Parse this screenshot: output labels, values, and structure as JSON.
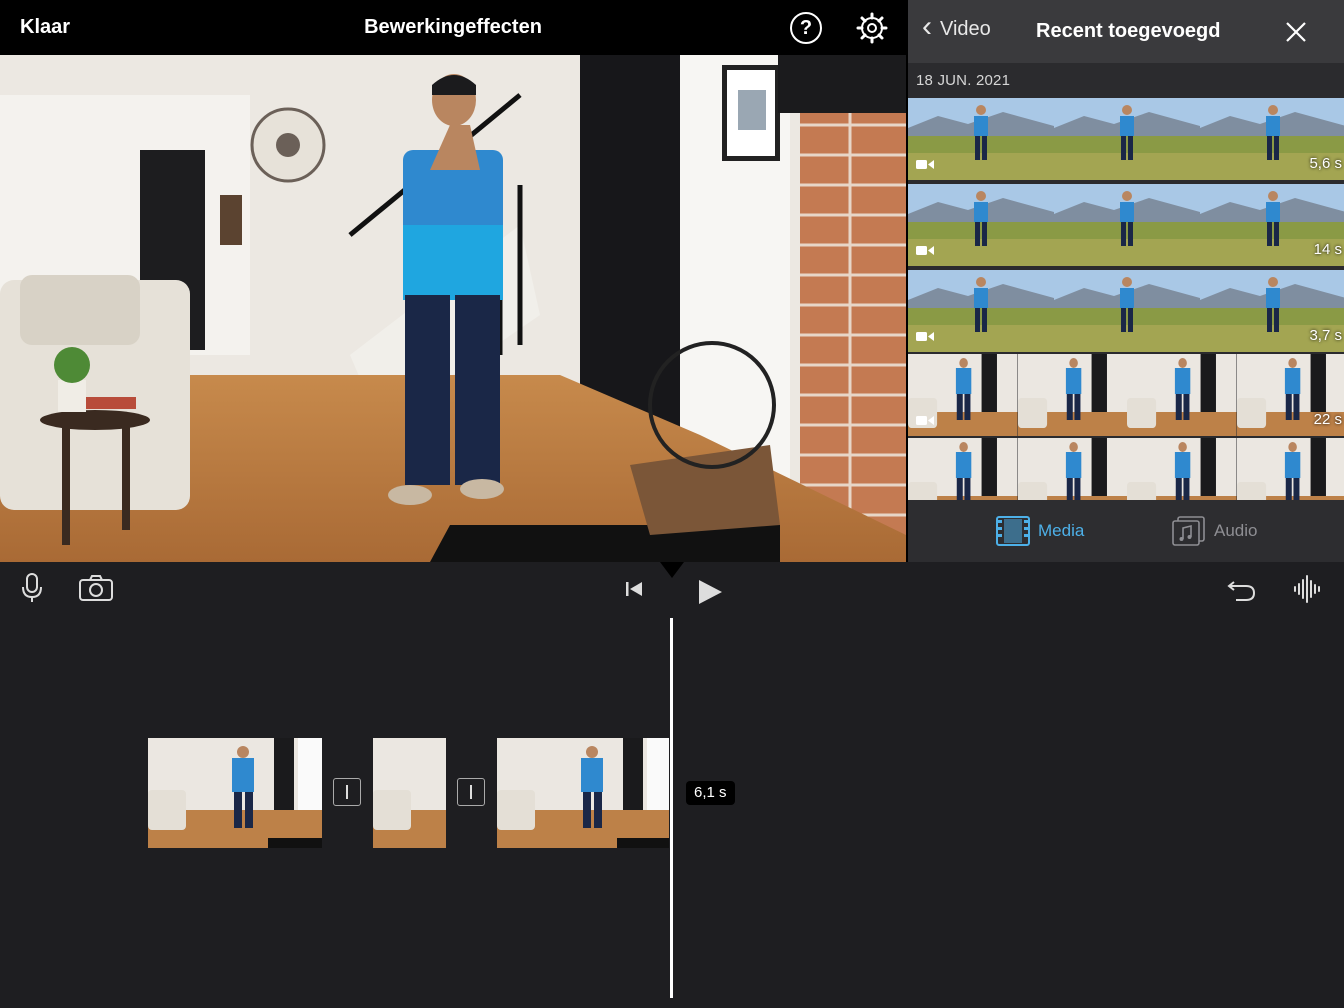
{
  "topbar": {
    "done_label": "Klaar",
    "title": "Bewerkingeffecten",
    "help_icon": "question-mark-icon",
    "settings_icon": "gear-icon"
  },
  "browser": {
    "back_label": "Video",
    "title": "Recent toegevoegd",
    "close_icon": "close-icon",
    "date": "18 JUN. 2021",
    "clips": [
      {
        "duration": "5,6 s",
        "scene": "field",
        "camera_badge": true
      },
      {
        "duration": "14 s",
        "scene": "field",
        "camera_badge": true
      },
      {
        "duration": "3,7 s",
        "scene": "field",
        "camera_badge": true
      },
      {
        "duration": "22 s",
        "scene": "room",
        "camera_badge": true
      },
      {
        "duration": "",
        "scene": "room",
        "camera_badge": false
      }
    ],
    "tabs": {
      "media_label": "Media",
      "audio_label": "Audio",
      "active": "Media"
    }
  },
  "toolbar": {
    "mic_icon": "microphone-icon",
    "camera_icon": "camera-icon",
    "skip_icon": "skip-to-start-icon",
    "play_icon": "play-icon",
    "undo_icon": "undo-icon",
    "waveform_icon": "audio-waveform-icon"
  },
  "timeline": {
    "clip_duration": "6,1 s",
    "clips": [
      "clip-1",
      "clip-2",
      "clip-3"
    ],
    "transitions": 2
  },
  "colors": {
    "accent": "#4db0e8",
    "background": "#1e1e21",
    "topbar": "#000000"
  }
}
